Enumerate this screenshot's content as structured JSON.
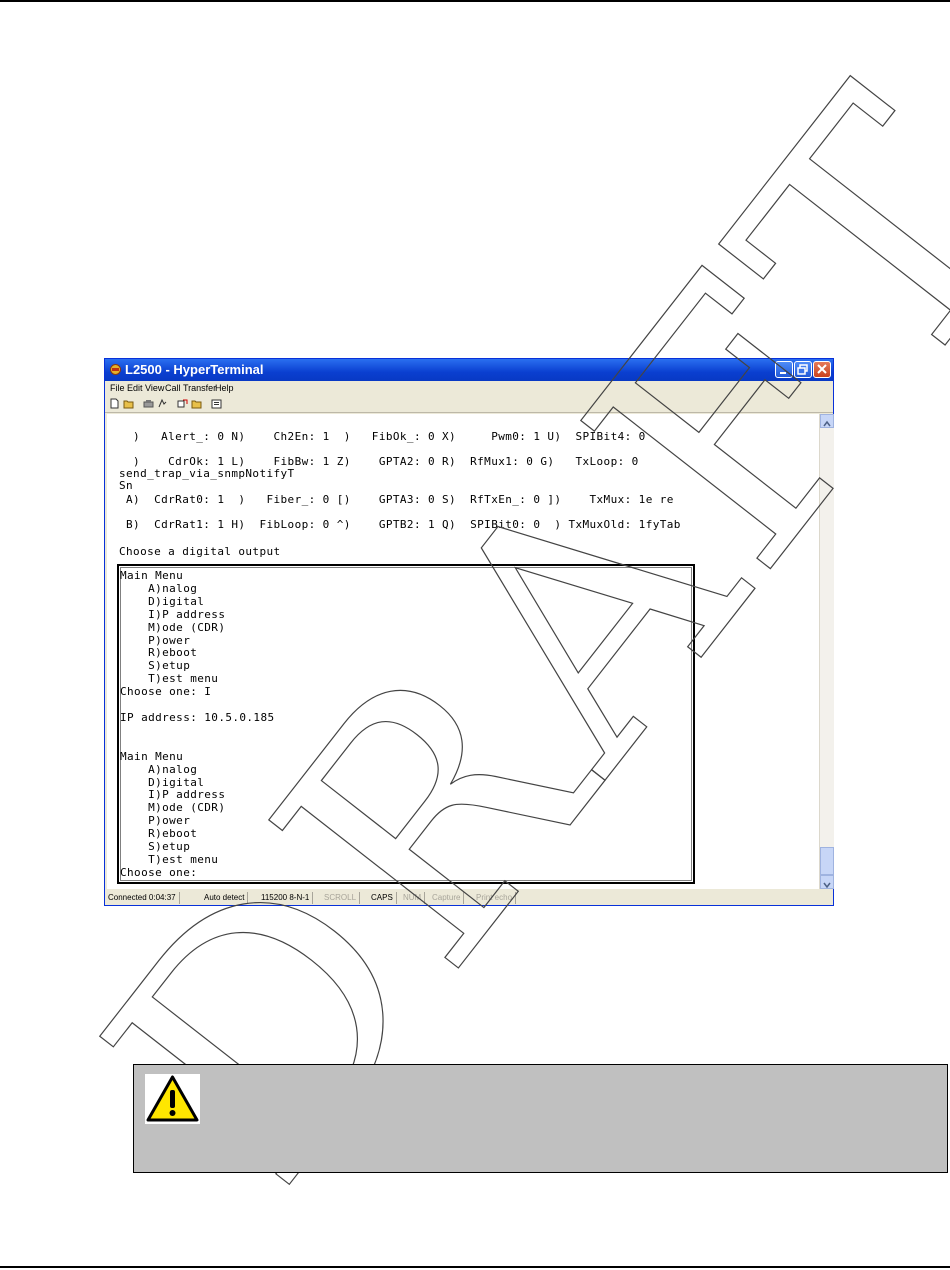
{
  "window": {
    "title": "L2500 - HyperTerminal",
    "menu": [
      "File",
      "Edit",
      "View",
      "Call",
      "Transfer",
      "Help"
    ]
  },
  "terminal": {
    "lines": [
      "  )   Alert_: 0 N)    Ch2En: 1  )   FibOk_: 0 X)     Pwm0: 1 U)  SPIBit4: 0",
      "  )    CdrOk: 1 L)    FibBw: 1 Z)    GPTA2: 0 R)  RfMux1: 0 G)   TxLoop: 0",
      "send_trap_via_snmpNotifyT",
      "Sn",
      " A)  CdrRat0: 1  )   Fiber_: 0 [)    GPTA3: 0 S)  RfTxEn_: 0 ])    TxMux: 1e re",
      " B)  CdrRat1: 1 H)  FibLoop: 0 ^)    GPTB2: 1 Q)  SPIBit0: 0  ) TxMuxOld: 1fyTab",
      "Choose a digital output"
    ],
    "inner_lines": [
      "Main Menu",
      "    A)nalog",
      "    D)igital",
      "    I)P address",
      "    M)ode (CDR)",
      "    P)ower",
      "    R)eboot",
      "    S)etup",
      "    T)est menu",
      "Choose one: I",
      "",
      "IP address: 10.5.0.185",
      "",
      "",
      "Main Menu",
      "    A)nalog",
      "    D)igital",
      "    I)P address",
      "    M)ode (CDR)",
      "    P)ower",
      "    R)eboot",
      "    S)etup",
      "    T)est menu",
      "Choose one:"
    ]
  },
  "statusbar": {
    "connected": "Connected 0:04:37",
    "detect": "Auto detect",
    "port": "115200 8-N-1",
    "scroll": "SCROLL",
    "caps": "CAPS",
    "num": "NUM",
    "capture": "Capture",
    "echo": "Print echo"
  },
  "watermark": {
    "text": "DRAFT"
  },
  "icons": {
    "warning": "warning-triangle-icon"
  }
}
